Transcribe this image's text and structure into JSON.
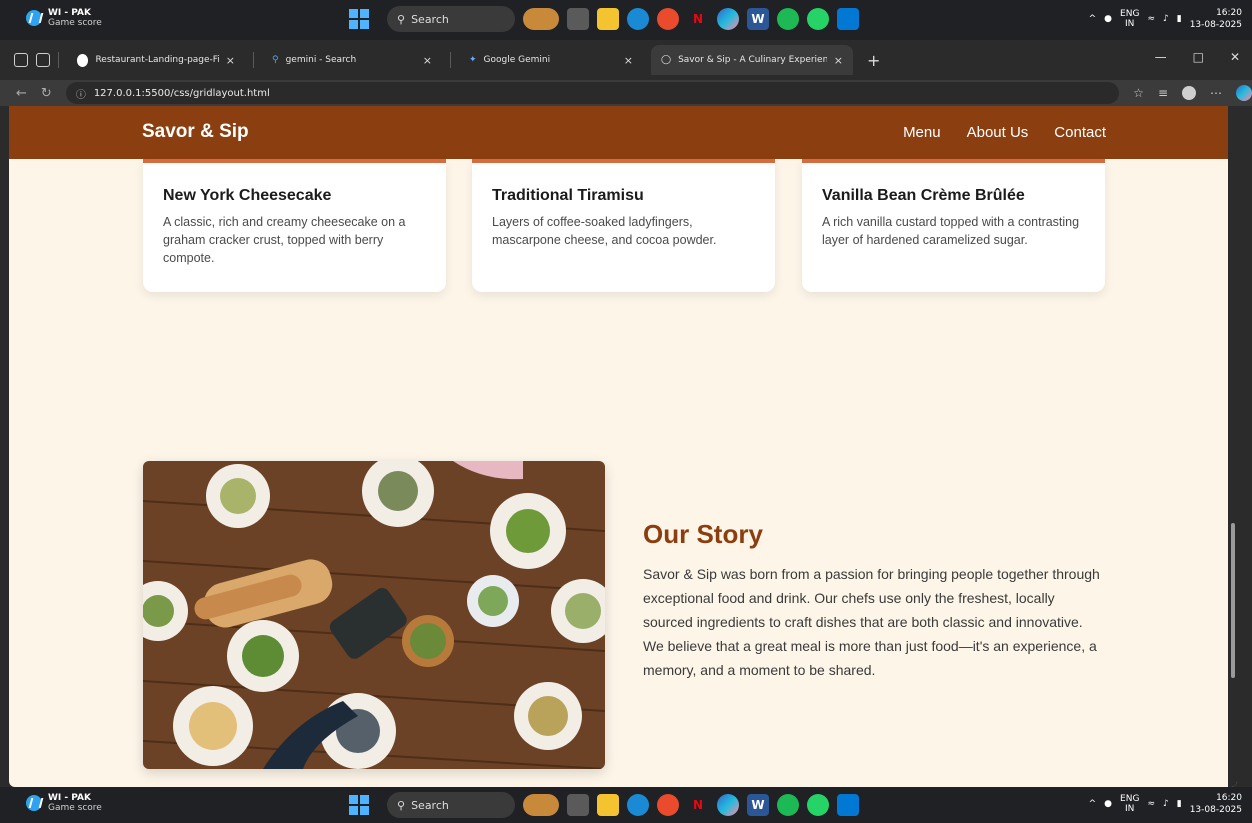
{
  "taskbar": {
    "widget_title": "WI - PAK",
    "widget_subtitle": "Game score",
    "search_label": "Search",
    "lang_top": "ENG",
    "lang_bottom": "IN",
    "time": "16:20",
    "date": "13-08-2025"
  },
  "browser": {
    "tabs": [
      {
        "label": "Restaurant-Landing-page-Final/i",
        "icon": "github-icon"
      },
      {
        "label": "gemini - Search",
        "icon": "search-icon"
      },
      {
        "label": "Google Gemini",
        "icon": "gemini-icon"
      },
      {
        "label": "Savor & Sip - A Culinary Experienc",
        "icon": "globe-icon"
      }
    ],
    "url": "127.0.0.1:5500/css/gridlayout.html"
  },
  "site": {
    "brand": "Savor & Sip",
    "nav": [
      "Menu",
      "About Us",
      "Contact"
    ],
    "cards": [
      {
        "title": "New York Cheesecake",
        "desc": "A classic, rich and creamy cheesecake on a graham cracker crust, topped with berry compote."
      },
      {
        "title": "Traditional Tiramisu",
        "desc": "Layers of coffee-soaked ladyfingers, mascarpone cheese, and cocoa powder."
      },
      {
        "title": "Vanilla Bean Crème Brûlée",
        "desc": "A rich vanilla custard topped with a contrasting layer of hardened caramelized sugar."
      }
    ],
    "story": {
      "title": "Our Story",
      "body": "Savor & Sip was born from a passion for bringing people together through exceptional food and drink. Our chefs use only the freshest, locally sourced ingredients to craft dishes that are both classic and innovative. We believe that a great meal is more than just food—it's an experience, a memory, and a moment to be shared."
    }
  },
  "colors": {
    "header": "#8b3f10",
    "accent": "#d76b40",
    "page_bg": "#fdf5e8"
  }
}
